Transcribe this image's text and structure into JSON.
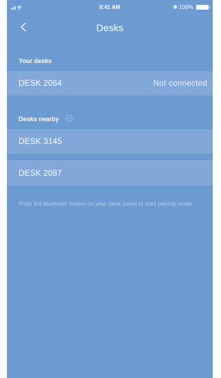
{
  "status_bar": {
    "signal": "•ııl",
    "time": "9:41 AM",
    "bluetooth": "✱",
    "battery_text": "100%"
  },
  "nav": {
    "title": "Desks",
    "back_icon": "chevron-left-icon"
  },
  "your_desks": {
    "header": "Your desks",
    "items": [
      {
        "label": "DESK 2064",
        "status": "Not connected"
      }
    ]
  },
  "desks_nearby": {
    "header": "Desks nearby",
    "scanning_icon": "spinner-icon",
    "items": [
      {
        "label": "DESK 3145"
      },
      {
        "label": "DESK 2087"
      }
    ]
  },
  "hint": "Push the bluetooth button on your desk panel to start pairing mode.",
  "colors": {
    "background": "#6c9bd2",
    "row": "#81a8d9",
    "text": "#ffffff"
  }
}
